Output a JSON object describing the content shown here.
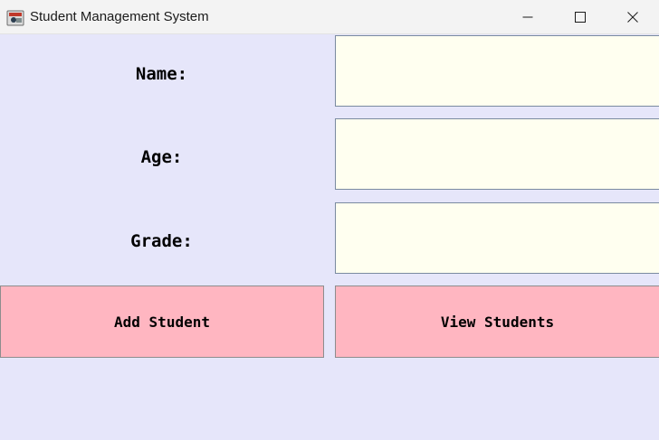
{
  "window": {
    "title": "Student Management System",
    "icons": {
      "app": "java-app-icon",
      "minimize": "minimize-icon",
      "maximize": "maximize-icon",
      "close": "close-icon"
    }
  },
  "form": {
    "name_label": "Name:",
    "age_label": "Age:",
    "grade_label": "Grade:",
    "name_value": "",
    "age_value": "",
    "grade_value": ""
  },
  "actions": {
    "add_label": "Add Student",
    "view_label": "View Students"
  },
  "colors": {
    "background": "#e6e6fa",
    "field_background": "#fffff0",
    "button_background": "#ffb6c1"
  }
}
